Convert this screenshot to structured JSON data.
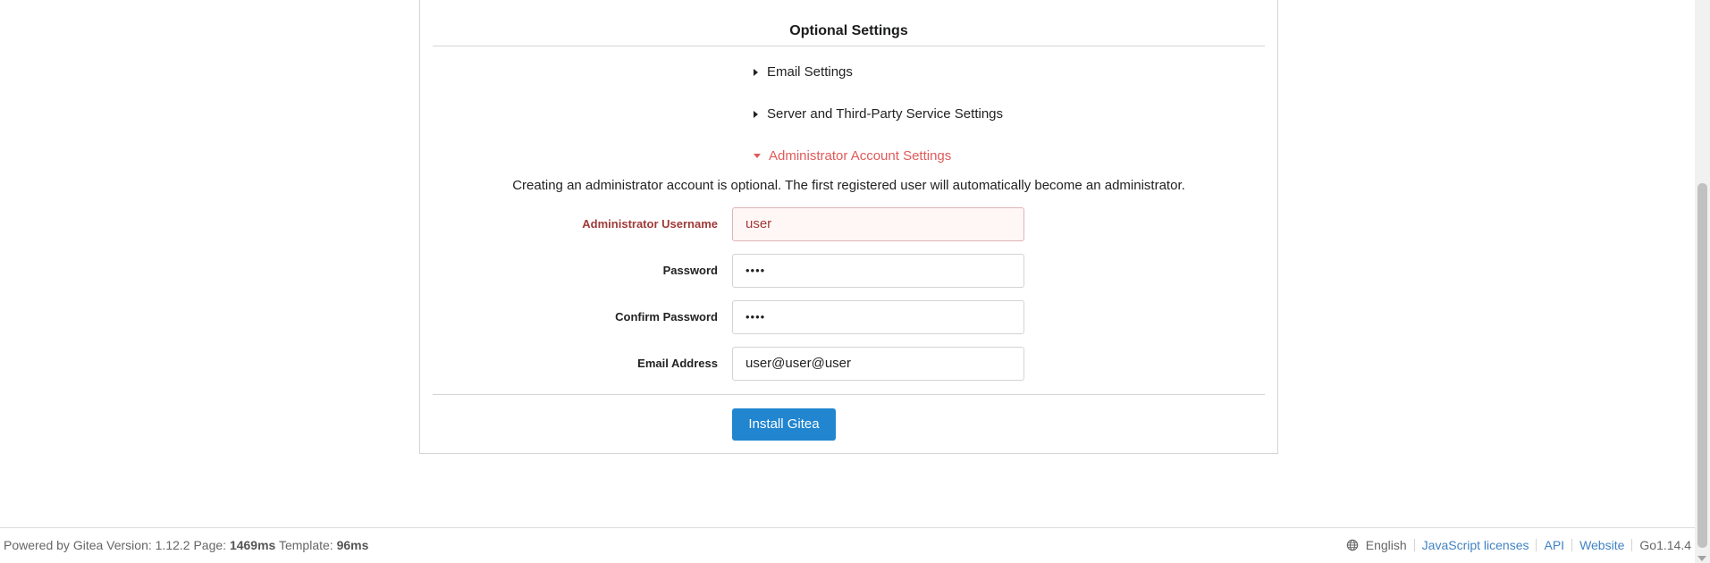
{
  "install": {
    "section_title": "Optional Settings",
    "accordion": [
      {
        "label": "Email Settings",
        "expanded": false
      },
      {
        "label": "Server and Third-Party Service Settings",
        "expanded": false
      },
      {
        "label": "Administrator Account Settings",
        "expanded": true
      }
    ],
    "admin_help": "Creating an administrator account is optional. The first registered user will automatically become an administrator.",
    "fields": {
      "username": {
        "label": "Administrator Username",
        "value": "user",
        "state": "error"
      },
      "password": {
        "label": "Password",
        "value": "••••"
      },
      "confirm_password": {
        "label": "Confirm Password",
        "value": "••••"
      },
      "email": {
        "label": "Email Address",
        "value": "user@user@user"
      }
    },
    "submit_label": "Install Gitea"
  },
  "footer": {
    "powered_by": "Powered by Gitea Version: 1.12.2 Page:",
    "page_time": "1469ms",
    "template_label": "Template:",
    "template_time": "96ms",
    "language": "English",
    "links": {
      "licenses": "JavaScript licenses",
      "api": "API",
      "website": "Website"
    },
    "go_version": "Go1.14.4"
  },
  "colors": {
    "primary": "#2185d0",
    "error_text": "#9f3a38",
    "active_accordion": "#e05a5a",
    "link": "#4183c4"
  }
}
